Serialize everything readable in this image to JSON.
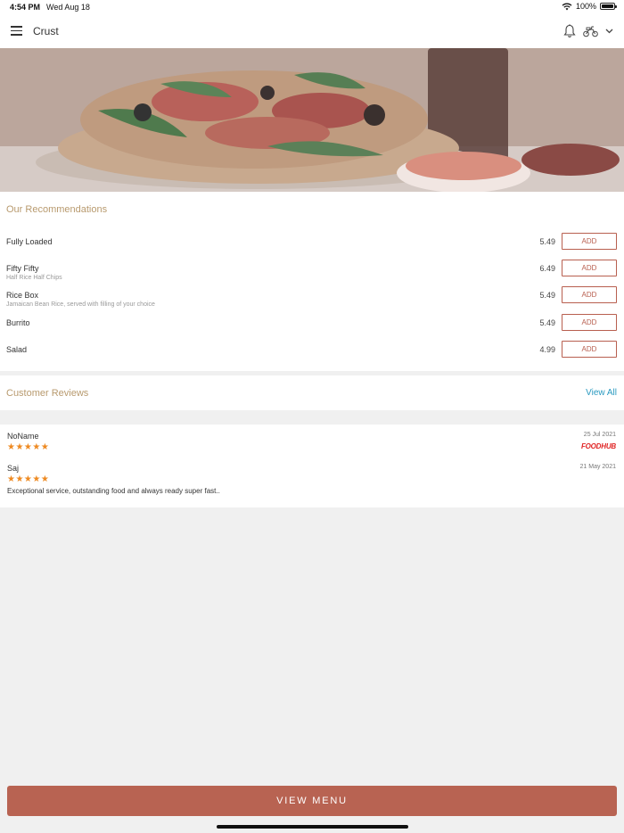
{
  "status_bar": {
    "time": "4:54 PM",
    "date": "Wed Aug 18",
    "battery": "100%",
    "wifi_icon": "wifi-icon",
    "battery_icon": "battery-icon"
  },
  "header": {
    "title": "Crust",
    "icons": [
      "menu-icon",
      "bell-icon",
      "scooter-icon",
      "chevron-down-icon"
    ]
  },
  "recommendations": {
    "title": "Our Recommendations",
    "items": [
      {
        "name": "Fully Loaded",
        "description": "",
        "price": "5.49",
        "button": "ADD"
      },
      {
        "name": "Fifty Fifty",
        "description": "Half Rice Half Chips",
        "price": "6.49",
        "button": "ADD"
      },
      {
        "name": "Rice Box",
        "description": "Jamaican Bean Rice, served with filling of your choice",
        "price": "5.49",
        "button": "ADD"
      },
      {
        "name": "Burrito",
        "description": "",
        "price": "5.49",
        "button": "ADD"
      },
      {
        "name": "Salad",
        "description": "",
        "price": "4.99",
        "button": "ADD"
      }
    ]
  },
  "reviews": {
    "title": "Customer Reviews",
    "view_all": "View All",
    "items": [
      {
        "name": "NoName",
        "stars": "★★★★★",
        "rating": 5,
        "date": "25 Jul 2021",
        "source": "FOODHUB",
        "text": ""
      },
      {
        "name": "Saj",
        "stars": "★★★★★",
        "rating": 5,
        "date": "21 May 2021",
        "source": "",
        "text": "Exceptional service, outstanding food and always ready super fast.."
      }
    ]
  },
  "footer": {
    "view_menu": "VIEW MENU"
  },
  "colors": {
    "accent": "#b86352",
    "section_title": "#b89a6e",
    "link": "#2a9ac0",
    "stars": "#ee8a22",
    "foodhub": "#e02424"
  }
}
